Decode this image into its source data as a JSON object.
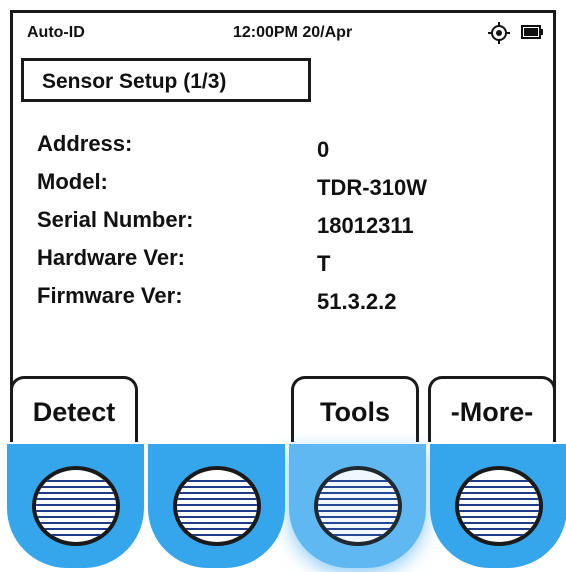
{
  "status": {
    "mode": "Auto-ID",
    "clock": "12:00PM 20/Apr",
    "gps_icon": "gps-target-icon",
    "battery_icon": "battery-full-icon"
  },
  "title": "Sensor Setup (1/3)",
  "fields": [
    {
      "label": "Address:",
      "value": "0"
    },
    {
      "label": "Model:",
      "value": "TDR-310W"
    },
    {
      "label": "Serial Number:",
      "value": "18012311"
    },
    {
      "label": "Hardware Ver:",
      "value": "T"
    },
    {
      "label": "Firmware Ver:",
      "value": "51.3.2.2"
    }
  ],
  "softkeys": {
    "key1": "Detect",
    "key2": "",
    "key3": "Tools",
    "key4": "-More-"
  },
  "colors": {
    "key_blue": "#36a6ec",
    "key_stripe": "#1e3a8a",
    "outline": "#1a1a1a"
  }
}
